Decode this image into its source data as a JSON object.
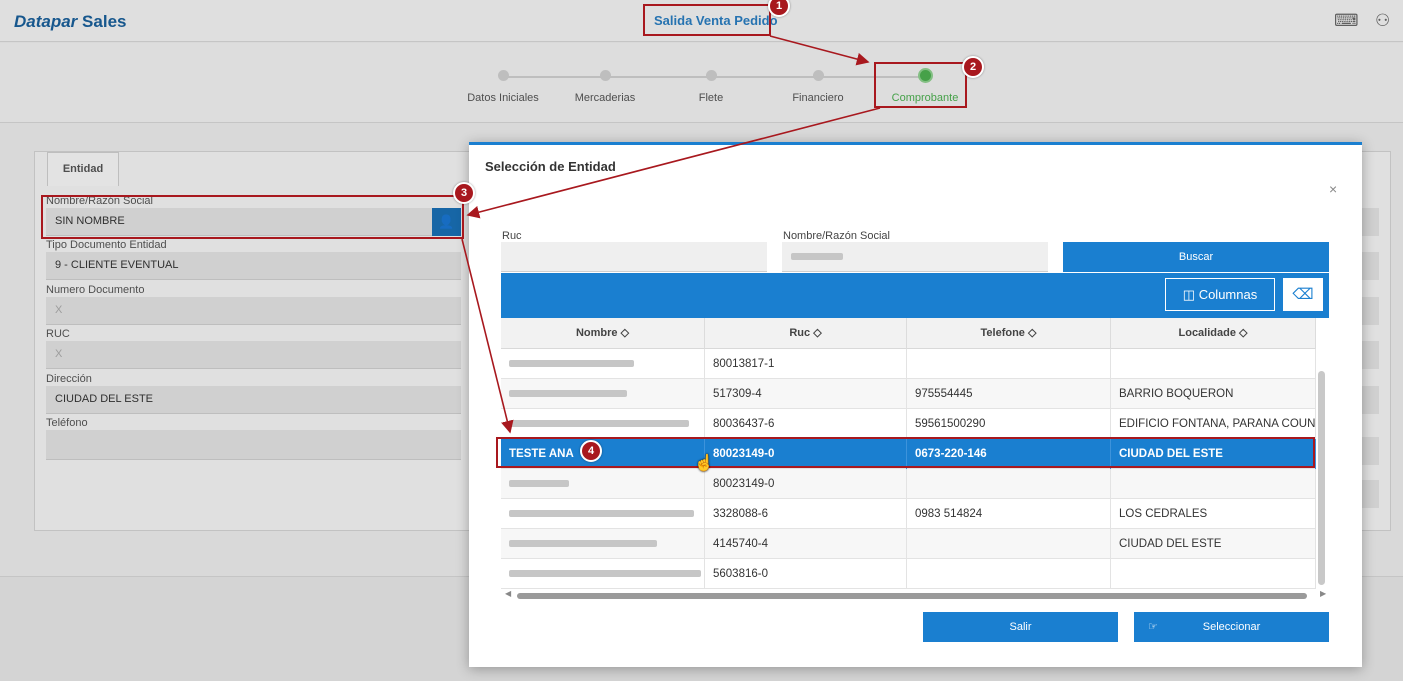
{
  "app": {
    "brand_italic": "Datapar",
    "brand_bold": "Sales",
    "page_title": "Salida Venta Pedido"
  },
  "topbar": {
    "icons": [
      "keyboard-icon",
      "switch-user-icon"
    ]
  },
  "stepper": {
    "steps": [
      "Datos Iniciales",
      "Mercaderias",
      "Flete",
      "Financiero",
      "Comprobante"
    ],
    "active": "Comprobante"
  },
  "form": {
    "tab": "Entidad",
    "nombre_label": "Nombre/Razón Social",
    "nombre_value": "SIN NOMBRE",
    "tipo_doc_label": "Tipo Documento Entidad",
    "tipo_doc_value": "9 - CLIENTE EVENTUAL",
    "num_doc_label": "Numero Documento",
    "num_doc_value": "X",
    "ruc_label": "RUC",
    "ruc_value": "X",
    "direccion_label": "Dirección",
    "direccion_value": "CIUDAD DEL ESTE",
    "telefono_label": "Teléfono",
    "telefono_value": ""
  },
  "modal": {
    "title": "Selección de Entidad",
    "close": "×",
    "ruc_label": "Ruc",
    "ruc_value": "",
    "nombre_label": "Nombre/Razón Social",
    "buscar": "Buscar",
    "columnas": "Columnas",
    "columns": [
      "Nombre",
      "Ruc",
      "Telefone",
      "Localidade"
    ],
    "sort_glyph": "◇",
    "rows": [
      {
        "nombre": "",
        "ruc": "80013817-1",
        "telefone": "",
        "localidade": ""
      },
      {
        "nombre": "",
        "ruc": "517309-4",
        "telefone": "975554445",
        "localidade": "BARRIO BOQUERON"
      },
      {
        "nombre": "",
        "ruc": "80036437-6",
        "telefone": "59561500290",
        "localidade": "EDIFICIO FONTANA, PARANA COUNTRY"
      },
      {
        "nombre": "TESTE ANA",
        "ruc": "80023149-0",
        "telefone": "0673-220-146",
        "localidade": "CIUDAD DEL ESTE"
      },
      {
        "nombre": "",
        "ruc": "80023149-0",
        "telefone": "",
        "localidade": ""
      },
      {
        "nombre": "",
        "ruc": "3328088-6",
        "telefone": "0983 514824",
        "localidade": "LOS CEDRALES"
      },
      {
        "nombre": "",
        "ruc": "4145740-4",
        "telefone": "",
        "localidade": "CIUDAD DEL ESTE"
      },
      {
        "nombre": "",
        "ruc": "5603816-0",
        "telefone": "",
        "localidade": ""
      }
    ],
    "selected_row": 3,
    "salir": "Salir",
    "seleccionar": "Seleccionar"
  },
  "annotations": {
    "badges": [
      "1",
      "2",
      "3",
      "4"
    ],
    "color": "#a8181e"
  },
  "colors": {
    "primary": "#1a7fd0",
    "brand": "#1a5f9a",
    "step_active": "#4caf50"
  }
}
